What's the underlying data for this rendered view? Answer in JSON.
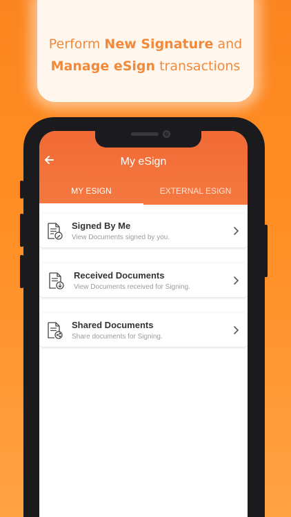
{
  "promo": {
    "line1_pre": "Perform ",
    "line1_bold": "New Signature",
    "line1_post": " and",
    "line2_bold": "Manage eSign",
    "line2_post": " transactions"
  },
  "header": {
    "title": "My eSign"
  },
  "tabs": [
    {
      "label": "MY ESIGN",
      "active": true
    },
    {
      "label": "EXTERNAL ESIGN",
      "active": false
    }
  ],
  "items": [
    {
      "title": "Signed By Me",
      "subtitle": "View Documents signed by you.",
      "icon": "doc-signed-icon"
    },
    {
      "title": "Received Documents",
      "subtitle": "View Documents received for Signing.",
      "icon": "doc-received-icon"
    },
    {
      "title": "Shared Documents",
      "subtitle": "Share documents for Signing.",
      "icon": "doc-shared-icon"
    }
  ],
  "colors": {
    "background": "#fb8520",
    "appbar": "#f26a36",
    "promo_text": "#f08a3a"
  }
}
